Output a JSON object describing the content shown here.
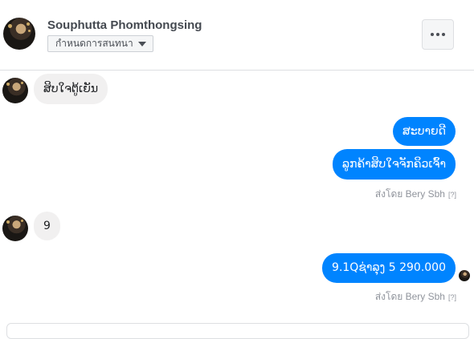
{
  "header": {
    "contact_name": "Souphutta Phomthongsing",
    "nickname_button": "กำหนดการสนทนา"
  },
  "messages": [
    {
      "direction": "in",
      "text": "ສິບໃຈຕູ້ເຍັນ"
    },
    {
      "direction": "out",
      "text": "ສະບາຍດີ"
    },
    {
      "direction": "out",
      "text": "ລູກຄ້າສິບໃຈຈັກຄິວເຈົ້າ"
    },
    {
      "direction": "in",
      "text": "9"
    },
    {
      "direction": "out",
      "text": "9.1Qຊ່າລຸງ 5 290.000"
    }
  ],
  "sent_by": {
    "label": "ส่งโดย Bery Sbh",
    "help": "[?]"
  },
  "icons": {
    "more": "more-dots-icon",
    "dropdown": "caret-down-icon"
  },
  "colors": {
    "outgoing_bubble": "#0084ff",
    "incoming_bubble": "#f1f0f0",
    "meta_text": "#90949c"
  }
}
